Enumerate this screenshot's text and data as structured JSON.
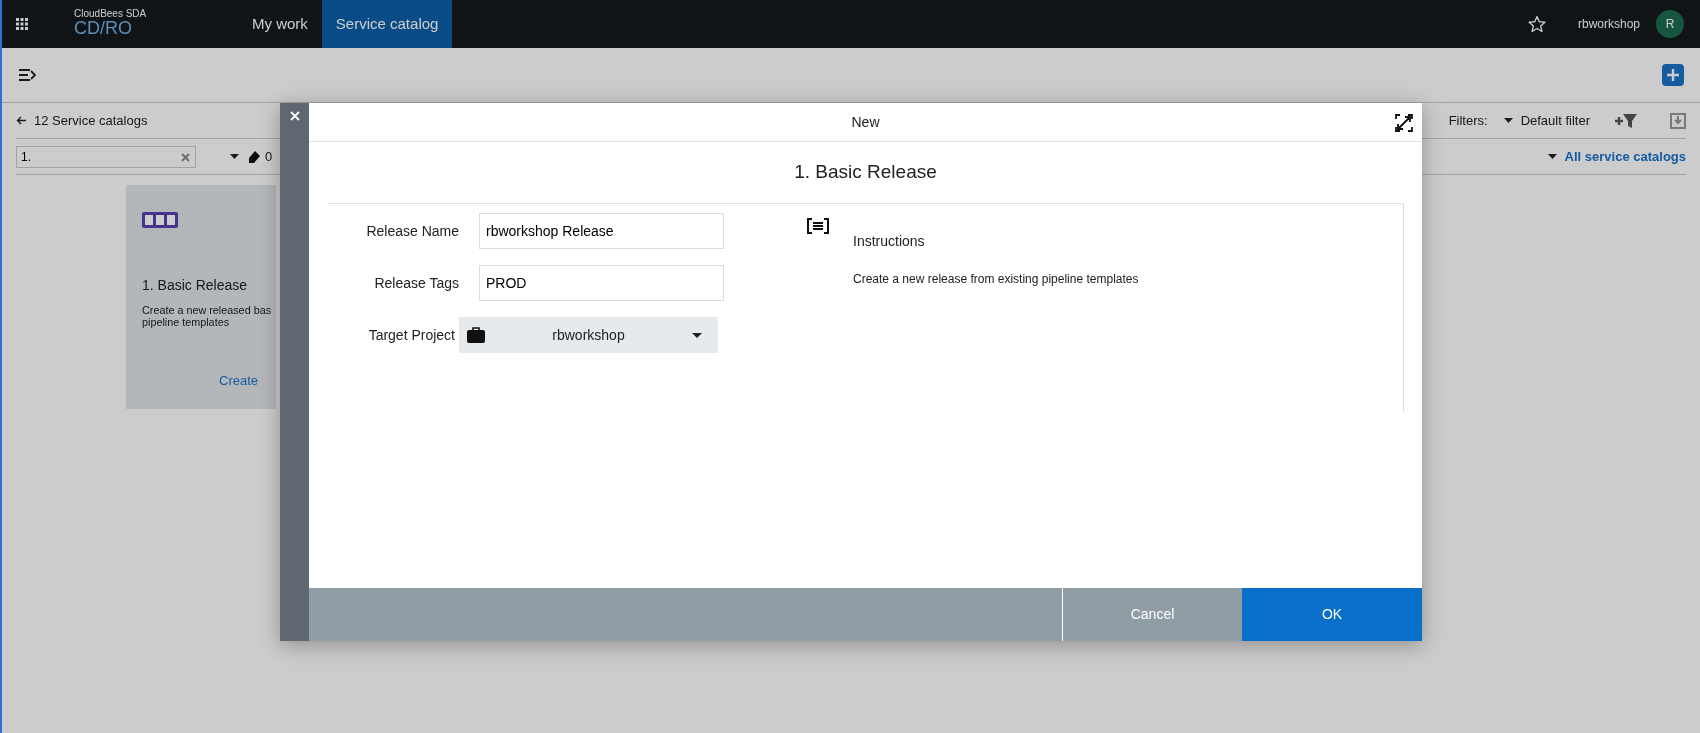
{
  "app": {
    "product": "CloudBees SDA",
    "name": "CD/RO"
  },
  "nav_tabs": [
    {
      "label": "My work",
      "selected": false
    },
    {
      "label": "Service catalog",
      "selected": true
    }
  ],
  "user": {
    "name": "rbworkshop",
    "avatar": "R"
  },
  "breadcrumb": "12 Service catalogs",
  "search": {
    "value": "1."
  },
  "tag_count": "0",
  "filters": {
    "label": "Filters:",
    "value": "Default filter"
  },
  "scope": "All service catalogs",
  "card": {
    "title": "1. Basic Release",
    "description": [
      "Create a new released bas",
      "pipeline templates"
    ],
    "action": "Create"
  },
  "dialog": {
    "title": "New",
    "heading": "1. Basic Release",
    "fields": [
      {
        "kind": "text",
        "label": "Release Name",
        "value": "rbworkshop Release"
      },
      {
        "kind": "text",
        "label": "Release Tags",
        "value": "PROD"
      },
      {
        "kind": "select",
        "label": "Target Project",
        "value": "rbworkshop"
      }
    ],
    "instructions": {
      "title": "Instructions",
      "text": "Create a new release from existing pipeline templates"
    },
    "buttons": [
      {
        "kind": "secondary",
        "label": "Cancel"
      },
      {
        "kind": "primary",
        "label": "OK"
      }
    ]
  }
}
